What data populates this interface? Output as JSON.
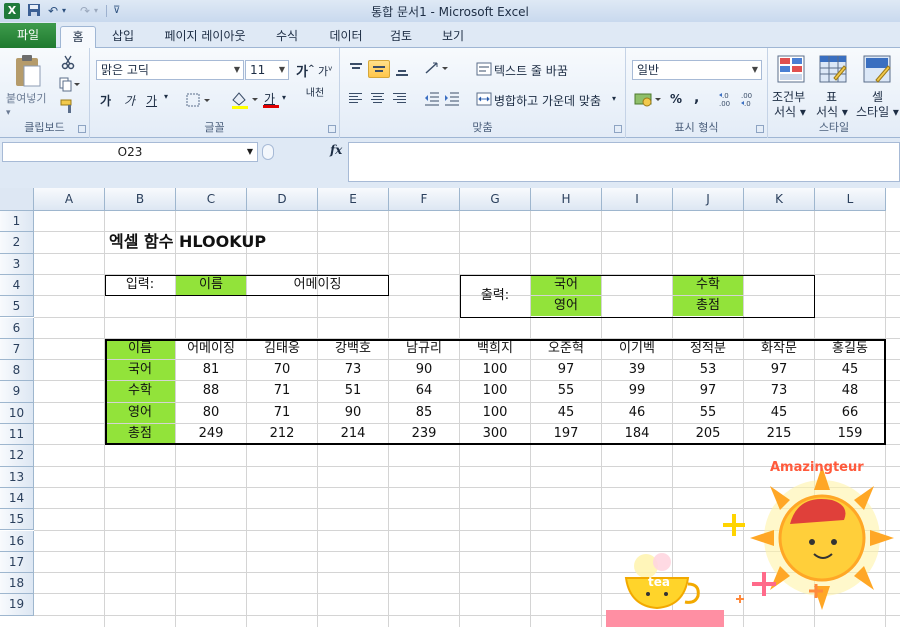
{
  "title_bar": {
    "title": "통합 문서1 - Microsoft Excel",
    "app_icon": "X"
  },
  "tabs": [
    "파일",
    "홈",
    "삽입",
    "페이지 레이아웃",
    "수식",
    "데이터",
    "검토",
    "보기"
  ],
  "ribbon": {
    "clipboard": {
      "paste_label": "붙여넣기",
      "group_label": "클립보드"
    },
    "font": {
      "font_name": "맑은 고딕",
      "font_size": "11",
      "group_label": "글꼴",
      "bold": "가",
      "italic": "가",
      "underline": "가",
      "grow": "가",
      "shrink": "가",
      "color_letter": "가",
      "phonetic": "내천"
    },
    "alignment": {
      "wrap_text": "텍스트 줄 바꿈",
      "merge_center": "병합하고 가운데 맞춤",
      "group_label": "맞춤"
    },
    "number": {
      "format": "일반",
      "percent": "%",
      "comma": ",",
      "group_label": "표시 형식"
    },
    "styles": {
      "conditional": "조건부",
      "conditional2": "서식 ▾",
      "table": "표",
      "table2": "서식 ▾",
      "cell": "셀",
      "cell2": "스타일 ▾",
      "group_label": "스타일"
    }
  },
  "formula_bar": {
    "name_box": "O23",
    "fx": "fx",
    "value": ""
  },
  "sheet": {
    "columns": [
      "A",
      "B",
      "C",
      "D",
      "E",
      "F",
      "G",
      "H",
      "I",
      "J",
      "K",
      "L"
    ],
    "rows": [
      "1",
      "2",
      "3",
      "4",
      "5",
      "6",
      "7",
      "8",
      "9",
      "10",
      "11",
      "12",
      "13",
      "14",
      "15",
      "16",
      "17",
      "18",
      "19"
    ],
    "title": "엑셀 함수 HLOOKUP",
    "input_label": "입력:",
    "input_key": "이름",
    "input_value": "어메이징",
    "output_label": "출력:",
    "output_keys": [
      "국어",
      "영어",
      "수학",
      "총점"
    ],
    "table": {
      "header": [
        "이름",
        "어메이징",
        "김태웅",
        "강백호",
        "남규리",
        "백희지",
        "오준혁",
        "이기벡",
        "정적분",
        "화작문",
        "홍길동"
      ],
      "rows": [
        [
          "국어",
          "81",
          "70",
          "73",
          "90",
          "100",
          "97",
          "39",
          "53",
          "97",
          "45"
        ],
        [
          "수학",
          "88",
          "71",
          "51",
          "64",
          "100",
          "55",
          "99",
          "97",
          "73",
          "48"
        ],
        [
          "영어",
          "80",
          "71",
          "90",
          "85",
          "100",
          "45",
          "46",
          "55",
          "45",
          "66"
        ],
        [
          "총점",
          "249",
          "212",
          "214",
          "239",
          "300",
          "197",
          "184",
          "205",
          "215",
          "159"
        ]
      ]
    }
  },
  "decoration": {
    "brand": "Amazingteur",
    "cup_text": "tea"
  },
  "colors": {
    "highlight_green": "#92e33a",
    "file_tab": "#2a8a3a"
  }
}
